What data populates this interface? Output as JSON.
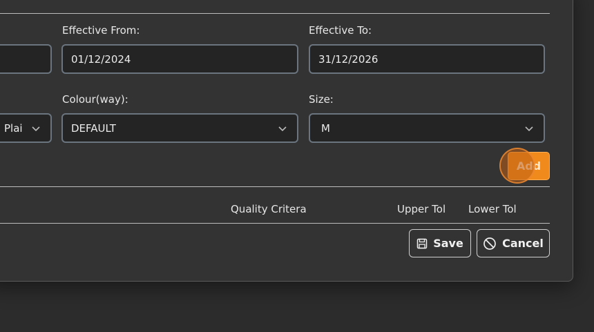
{
  "form": {
    "effective_from": {
      "label": "Effective From:",
      "value": "01/12/2024"
    },
    "effective_to": {
      "label": "Effective To:",
      "value": "31/12/2026"
    },
    "style_select": {
      "value": "Plai"
    },
    "colourway": {
      "label": "Colour(way):",
      "value": "DEFAULT"
    },
    "size": {
      "label": "Size:",
      "value": "M"
    }
  },
  "actions": {
    "add_label": "Add",
    "save_label": "Save",
    "cancel_label": "Cancel"
  },
  "table": {
    "columns": [
      "Quality Critera",
      "Upper Tol",
      "Lower Tol"
    ]
  },
  "icons": {
    "save": "floppy-disk-icon",
    "cancel": "prohibited-icon",
    "dropdown": "chevron-down-icon"
  },
  "colors": {
    "accent": "#f08a1c",
    "background": "#333333",
    "field": "#242424"
  }
}
